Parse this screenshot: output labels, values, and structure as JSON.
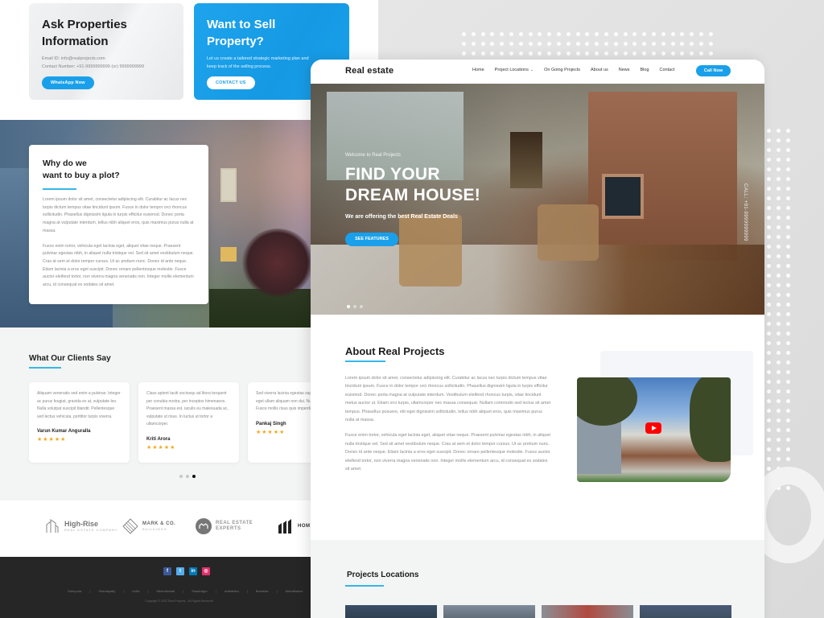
{
  "left_page": {
    "ask_card": {
      "title_line1": "Ask Properties",
      "title_line2": "Information",
      "email": "Email ID: info@realprojects.com",
      "contact": "Contact Number: +91-9999999999 (or) 9999999999",
      "button": "WhatsApp Now"
    },
    "sell_card": {
      "title_line1": "Want to Sell",
      "title_line2": "Property?",
      "text": "Let us create a tailored strategic marketing plan and keep track of the selling process.",
      "button": "CONTACT US"
    },
    "why_card": {
      "title_line1": "Why do we",
      "title_line2": "want to buy a plot?",
      "para1": "Lorem ipsum dolor sit amet, consectetur adipiscing elit. Curabitur ac lacus nec turpis dictum tempus vitae tincidunt ipsum. Fusce in dolor tempor orci rhoncus sollicitudin. Phasellus dignissim ligula in turpis efficitur euismod. Donec porta magna at vulputate interdum, tellus nibh aliquet eros, quis maximus purus nulla at massa.",
      "para2": "Fusce enim tortor, vehicula eget lacinia eget, aliquet vitae neque. Praesent pulvinar egestas nibh, in aliquet nulla tristique vel. Sed sit amet vestibulum neque. Cras at sem et dolor tempor cursus. Ut ac pretium nunc. Donec id ante neque. Etiam lacinia a eros eget suscipit. Donec ornare pellentesque molestie. Fusce auctor eleifend tortor, non viverra magna venenatis non. Integer mollis elementum arcu, id consequat ex sodales sit amet."
    },
    "clients": {
      "title": "What Our Clients Say",
      "reviews": [
        {
          "text": "Aliquam venenatis sed enim a pulvinar. Integer ac purus feugiat, gravida ex at, vulputate leo. Nulla volutpat suscipit blandit. Pellentesque sed lectus vehicula, porttitor turpis viverra.",
          "name": "Varun Kumar Anguralla",
          "stars": "★★★★★",
          "rating": 5
        },
        {
          "text": "Class aptent taciti sociosqu ad litora torquent per conubia nostra, per inceptos himenaeos. Praesent massa est, iaculis eu malesuada ac, vulputate ut risus. In luctus ut tortor a ullamcorper.",
          "name": "Kriti Arora",
          "stars": "★★★★★",
          "rating": 5
        },
        {
          "text": "Sed viverra lacinia egestas sapien, tincidunt eget ullam aliquam non dui. Nunc sit a nibh. Fusce mollis risus quis imperdiet.",
          "name": "Pankaj Singh",
          "stars": "★★★★★",
          "rating": 5
        }
      ],
      "active_dot": 3,
      "dot_count": 3
    },
    "partners": [
      {
        "name": "High-Rise",
        "tagline": "REAL ESTATE COMPANY"
      },
      {
        "name": "MARK & CO.",
        "tagline": "BUILDINGS"
      },
      {
        "name": "REAL ESTATE",
        "tagline": "EXPERTS"
      },
      {
        "name": "HOM",
        "tagline": ""
      }
    ],
    "footer": {
      "socials": [
        {
          "name": "facebook",
          "glyph": "f",
          "color": "#3b5998"
        },
        {
          "name": "twitter",
          "glyph": "t",
          "color": "#55acee"
        },
        {
          "name": "linkedin",
          "glyph": "in",
          "color": "#0077b5"
        },
        {
          "name": "instagram",
          "glyph": "◎",
          "color": "#e1306c"
        }
      ],
      "links": [
        "Sahupura",
        "Shantapally",
        "Kofla",
        "Meenakshati",
        "Shastragur",
        "Adilabetta",
        "Banahiar",
        "Mahalkasuri"
      ],
      "copyright": "Copyright © 2022 Real Projects - All Rights Reserved"
    }
  },
  "front_page": {
    "nav": {
      "brand": "Real estate",
      "links": [
        "Home",
        "Project Locations",
        "On Going Projects",
        "About us",
        "News",
        "Blog",
        "Contact"
      ],
      "dropdown_index": 1,
      "cta": "Call Now"
    },
    "hero": {
      "welcome": "Welcome to Real Projects",
      "title_line1": "FIND YOUR",
      "title_line2": "DREAM HOUSE!",
      "subtitle": "We are offering the best Real Estate Deals",
      "button": "SEE FEATURES",
      "call_vertical": "CALL: +91-9999999999",
      "active_slide": 1,
      "slide_count": 3
    },
    "about": {
      "title": "About Real Projects",
      "para1": "Lorem ipsum dolor sit amet, consectetur adipiscing elit. Curabitur ac lacus nec turpis dictum tempus vitae tincidunt ipsum. Fusce in dolor tempor orci rhoncus sollicitudin. Phasellus dignissim ligula in turpis efficitur euismod. Donec porta magna at vulputate interdum. Vestibulum eleifend rhoncus turpis, vitae tincidunt metus auctor ut. Etiam orci turpis, ullamcorper nec massa consequat. Nullam commodo sed lectus sit amet tempus. Phasellus posuere, elit eget dignissim sollicitudin, tellus nibh aliquet eros, quis maximus purus nulla at massa.",
      "para2": "Fusce enim tortor, vehicula eget lacinia eget, aliquet vitae neque. Praesent pulvinar egestas nibh, in aliquet nulla tristique vel. Sed sit amet vestibulum neque. Cras at sem et dolor tempor cursus. Ut ac pretium nunc. Donec id ante neque. Etiam lacinia a eros eget suscipit. Donec ornare pellentesque molestie. Fusce auctor eleifend tortor, non viverra magna venenatis non. Integer mollis elementum arcu, id consequat ex sodales sit amet.",
      "video_icon": "play-icon"
    },
    "locations": {
      "title": "Projects Locations"
    }
  },
  "colors": {
    "accent": "#1aa0ea",
    "accent_line": "#37b6e6",
    "star": "#f2a922",
    "footer_bg": "#262626",
    "play_red": "#ff0000"
  }
}
